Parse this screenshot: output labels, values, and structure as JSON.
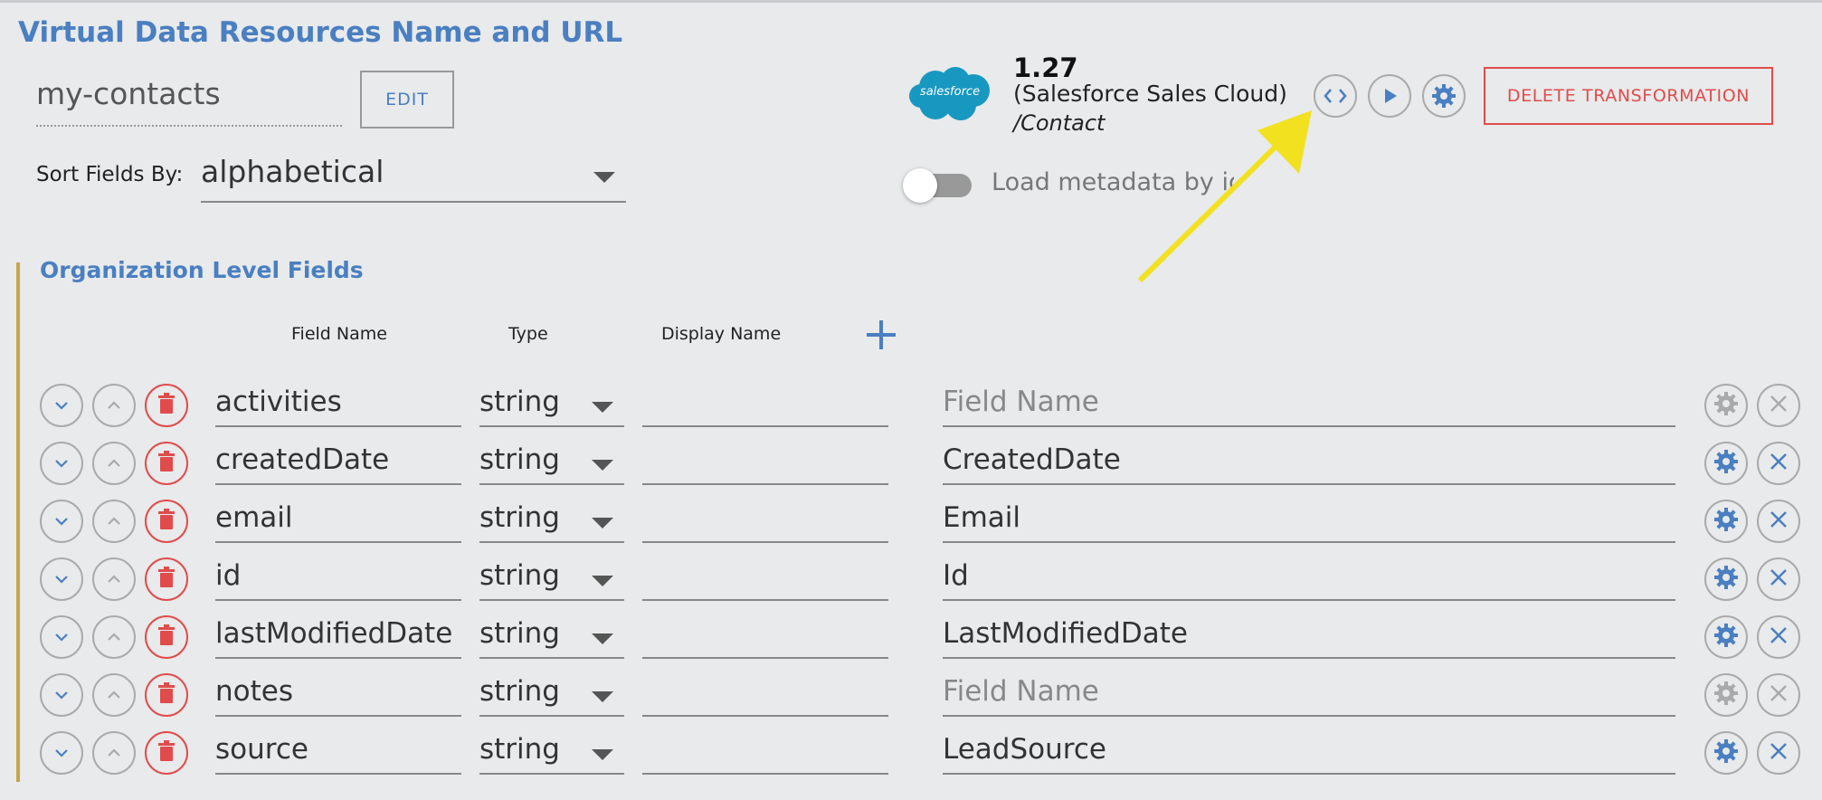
{
  "header": {
    "title": "Virtual Data Resources Name and URL",
    "resource_name": "my-contacts",
    "edit_label": "EDIT"
  },
  "sort": {
    "label": "Sort Fields By:",
    "value": "alphabetical"
  },
  "connector": {
    "logo_text": "salesforce",
    "version": "1.27",
    "name": "(Salesforce Sales Cloud)",
    "path": "/Contact",
    "delete_label": "DELETE TRANSFORMATION",
    "toggle_label": "Load metadata by id",
    "toggle_on": false
  },
  "org": {
    "title": "Organization Level Fields",
    "columns": {
      "field_name": "Field Name",
      "type": "Type",
      "display_name": "Display Name"
    }
  },
  "rows": [
    {
      "field": "activities",
      "type": "string",
      "display": "",
      "mapping": "",
      "mapping_placeholder": "Field Name",
      "active": false
    },
    {
      "field": "createdDate",
      "type": "string",
      "display": "",
      "mapping": "CreatedDate",
      "mapping_placeholder": "Field Name",
      "active": true
    },
    {
      "field": "email",
      "type": "string",
      "display": "",
      "mapping": "Email",
      "mapping_placeholder": "Field Name",
      "active": true
    },
    {
      "field": "id",
      "type": "string",
      "display": "",
      "mapping": "Id",
      "mapping_placeholder": "Field Name",
      "active": true
    },
    {
      "field": "lastModifiedDate",
      "type": "string",
      "display": "",
      "mapping": "LastModifiedDate",
      "mapping_placeholder": "Field Name",
      "active": true
    },
    {
      "field": "notes",
      "type": "string",
      "display": "",
      "mapping": "",
      "mapping_placeholder": "Field Name",
      "active": false
    },
    {
      "field": "source",
      "type": "string",
      "display": "",
      "mapping": "LeadSource",
      "mapping_placeholder": "Field Name",
      "active": true
    }
  ],
  "colors": {
    "accent": "#4a7fc1",
    "danger": "#e04c4c",
    "salesforce": "#1798c1",
    "arrow": "#f2e11f",
    "org_bar": "#c8a64a"
  }
}
